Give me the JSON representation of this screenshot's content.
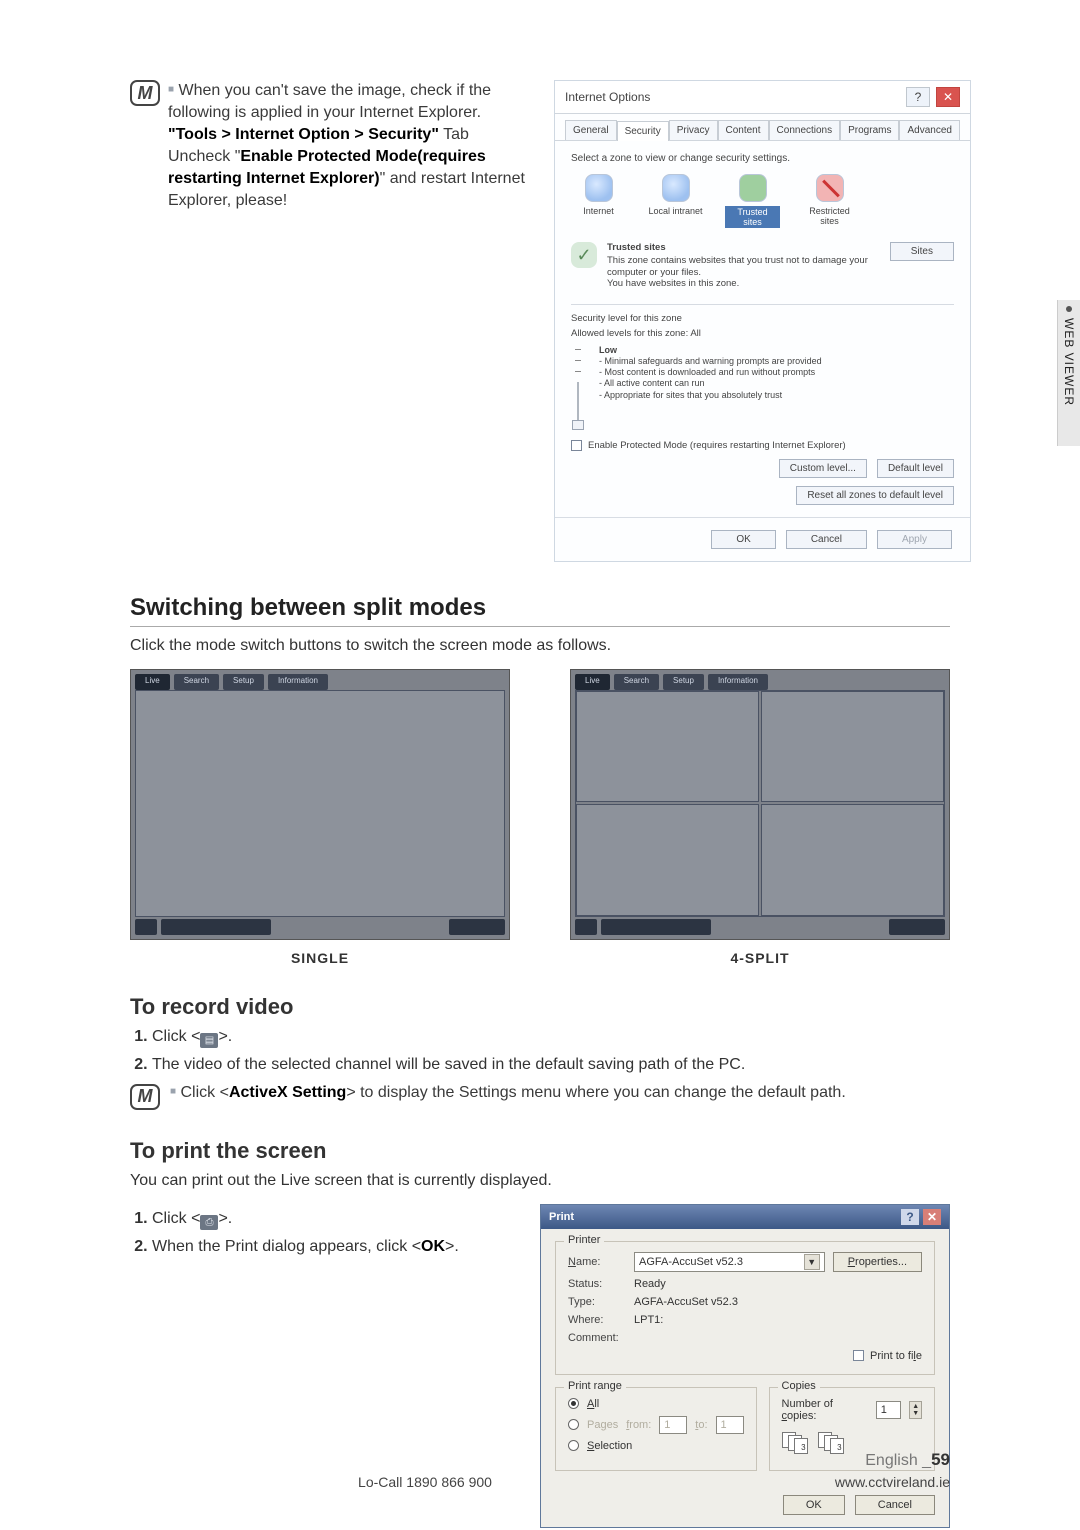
{
  "sidebar_tab": "WEB VIEWER",
  "top_note": {
    "lead": "When you can't save the image, check if the following is applied in your Internet Explorer.",
    "path": "\"Tools > Internet Option > Security\"",
    "mid": " Tab Uncheck \"",
    "bold2": "Enable Protected Mode(requires restarting Internet Explorer)",
    "tail": "\" and restart Internet Explorer, please!"
  },
  "ie": {
    "title": "Internet Options",
    "tabs": [
      "General",
      "Security",
      "Privacy",
      "Content",
      "Connections",
      "Programs",
      "Advanced"
    ],
    "select_zone": "Select a zone to view or change security settings.",
    "zones": [
      "Internet",
      "Local intranet",
      "Trusted sites",
      "Restricted sites"
    ],
    "trusted": {
      "title": "Trusted sites",
      "desc1": "This zone contains websites that you trust not to damage your computer or your files.",
      "desc2": "You have websites in this zone.",
      "sites_btn": "Sites"
    },
    "sec_level_label": "Security level for this zone",
    "allowed": "Allowed levels for this zone: All",
    "low_label": "Low",
    "low_bullets": [
      "- Minimal safeguards and warning prompts are provided",
      "- Most content is downloaded and run without prompts",
      "- All active content can run",
      "- Appropriate for sites that you absolutely trust"
    ],
    "epm": "Enable Protected Mode (requires restarting Internet Explorer)",
    "custom_btn": "Custom level...",
    "default_btn": "Default level",
    "reset_btn": "Reset all zones to default level",
    "ok": "OK",
    "cancel": "Cancel",
    "apply": "Apply"
  },
  "switch": {
    "heading": "Switching between split modes",
    "desc": "Click the mode switch buttons to switch the screen mode as follows.",
    "pill_live": "Live",
    "pill_items": [
      "Search",
      "Setup",
      "Information"
    ],
    "single_caption": "SINGLE",
    "split_caption": "4-SPLIT"
  },
  "record": {
    "heading": "To record video",
    "step1a": "Click <",
    "step1b": ">.",
    "step2": "The video of the selected channel will be saved in the default saving path of the PC.",
    "note_a": "Click <",
    "note_bold": "ActiveX Setting",
    "note_b": "> to display the Settings menu where you can change the default path."
  },
  "print": {
    "heading": "To print the screen",
    "desc": "You can print out the Live screen that is currently displayed.",
    "step1a": "Click <",
    "step1b": ">.",
    "step2a": "When the Print dialog appears, click <",
    "step2_bold": "OK",
    "step2b": ">."
  },
  "pd": {
    "title": "Print",
    "printer_box": "Printer",
    "name_l": "Name:",
    "name_v": "AGFA-AccuSet v52.3",
    "properties": "Properties...",
    "status_l": "Status:",
    "status_v": "Ready",
    "type_l": "Type:",
    "type_v": "AGFA-AccuSet v52.3",
    "where_l": "Where:",
    "where_v": "LPT1:",
    "comment_l": "Comment:",
    "print_to_file": "Print to file",
    "range_box": "Print range",
    "all": "All",
    "pages_l": "Pages",
    "from": "from:",
    "to": "to:",
    "from_v": "1",
    "to_v": "1",
    "selection": "Selection",
    "copies_box": "Copies",
    "num_copies": "Number of copies:",
    "copies_v": "1",
    "ok": "OK",
    "cancel": "Cancel"
  },
  "footer": {
    "eng": "English _",
    "page": "59",
    "locall": "Lo-Call  1890 866 900",
    "site": "www.cctvireland.ie"
  }
}
